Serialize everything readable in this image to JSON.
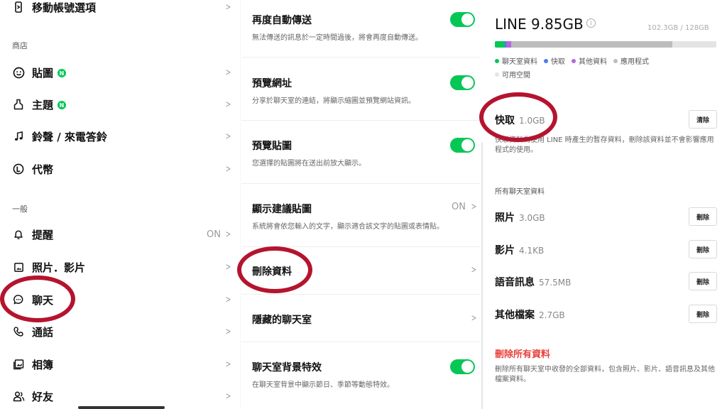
{
  "left": {
    "items": [
      {
        "label": "移動帳號選項",
        "icon": "phone-transfer-icon"
      },
      {
        "label": "貼圖",
        "icon": "smiley-icon",
        "badge": "N"
      },
      {
        "label": "主題",
        "icon": "theme-icon",
        "badge": "N"
      },
      {
        "label": "鈴聲 / 來電答鈴",
        "icon": "music-note-icon"
      },
      {
        "label": "代幣",
        "icon": "coin-icon"
      },
      {
        "label": "提醒",
        "icon": "bell-icon",
        "value": "ON"
      },
      {
        "label": "照片．影片",
        "icon": "photo-icon"
      },
      {
        "label": "聊天",
        "icon": "chat-bubble-icon"
      },
      {
        "label": "通話",
        "icon": "phone-icon"
      },
      {
        "label": "相簿",
        "icon": "album-icon"
      },
      {
        "label": "好友",
        "icon": "friends-icon"
      }
    ],
    "sections": {
      "shop": "商店",
      "general": "一般"
    }
  },
  "middle": {
    "items": [
      {
        "title": "再度自動傳送",
        "subtitle": "無法傳送的訊息於一定時間過後，將會再度自動傳送。",
        "toggle": true
      },
      {
        "title": "預覽網址",
        "subtitle": "分享於聊天室的連結，將顯示縮圖並預覽網站資訊。",
        "toggle": true
      },
      {
        "title": "預覽貼圖",
        "subtitle": "您選擇的貼圖將在送出前放大顯示。",
        "toggle": true
      },
      {
        "title": "顯示建議貼圖",
        "subtitle": "系統將會依您輸入的文字，顯示適合該文字的貼圖或表情貼。",
        "value": "ON"
      },
      {
        "title": "刪除資料"
      },
      {
        "title": "隱藏的聊天室"
      },
      {
        "title": "聊天室背景特效",
        "subtitle": "在聊天室背景中顯示節日、季節等動態特效。",
        "toggle": true
      }
    ]
  },
  "right": {
    "title": "LINE 9.85GB",
    "total": "102.3GB / 128GB",
    "bar": {
      "chat": 0.044,
      "cache": 0.008,
      "other": 0.021,
      "apps": 0.727,
      "colors": {
        "chat": "#06c755",
        "cache": "#4a7cf0",
        "other": "#b266e0",
        "apps": "#bdbdbd",
        "free": "#e4e4e4"
      }
    },
    "legend": [
      "聊天室資料",
      "快取",
      "其他資料",
      "應用程式",
      "可用空間"
    ],
    "cache": {
      "name": "快取",
      "size": "1.0GB",
      "button": "清除",
      "desc": "快取資料為使用 LINE 時產生的暫存資料，刪除該資料並不會影響應用程式的使用。"
    },
    "section_all": "所有聊天室資料",
    "data_items": [
      {
        "name": "照片",
        "size": "3.0GB",
        "button": "刪除"
      },
      {
        "name": "影片",
        "size": "4.1KB",
        "button": "刪除"
      },
      {
        "name": "語音訊息",
        "size": "57.5MB",
        "button": "刪除"
      },
      {
        "name": "其他檔案",
        "size": "2.7GB",
        "button": "刪除"
      }
    ],
    "delete_all": {
      "label": "刪除所有資料",
      "desc": "刪除所有聊天室中收發的全部資料，包含照片、影片、語音訊息及其他檔案資料。"
    }
  },
  "colors": {
    "accent": "#06c755",
    "highlight_circle": "#b5142e",
    "danger": "#e8403b"
  }
}
